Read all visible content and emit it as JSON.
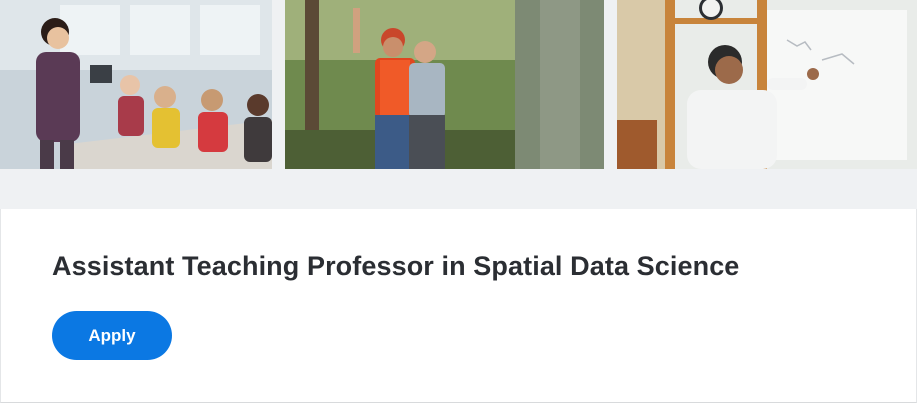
{
  "banner": {
    "photos": [
      {
        "icon": "classroom-discussion-photo"
      },
      {
        "icon": "field-research-photo"
      },
      {
        "icon": "whiteboard-lecture-photo"
      }
    ]
  },
  "job": {
    "title": "Assistant Teaching Professor in Spatial Data Science",
    "apply_label": "Apply"
  },
  "colors": {
    "accent": "#0b78e3",
    "title_text": "#2b2e33",
    "banner_bg": "#eff1f3"
  }
}
